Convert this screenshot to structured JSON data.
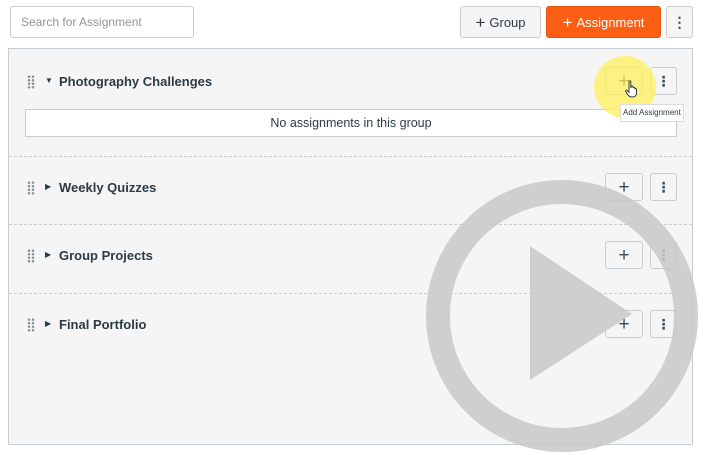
{
  "toolbar": {
    "search_placeholder": "Search for Assignment",
    "group_button_label": "Group",
    "assignment_button_label": "Assignment"
  },
  "groups": [
    {
      "title": "Photography Challenges",
      "expanded": true,
      "empty_message": "No assignments in this group"
    },
    {
      "title": "Weekly Quizzes",
      "expanded": false
    },
    {
      "title": "Group Projects",
      "expanded": false
    },
    {
      "title": "Final Portfolio",
      "expanded": false
    }
  ],
  "tooltip": {
    "text": "Add Assignment"
  },
  "icons": {
    "plus": "plus-icon",
    "kebab": "kebab-menu-icon",
    "drag": "drag-handle-icon",
    "caret_down": "caret-down-icon",
    "caret_right": "caret-right-icon",
    "cursor": "hand-cursor-icon",
    "play": "play-icon"
  },
  "colors": {
    "accent": "#fc5e13",
    "text": "#2d3b45",
    "border": "#c7cdd1",
    "highlight": "#fff05a"
  }
}
